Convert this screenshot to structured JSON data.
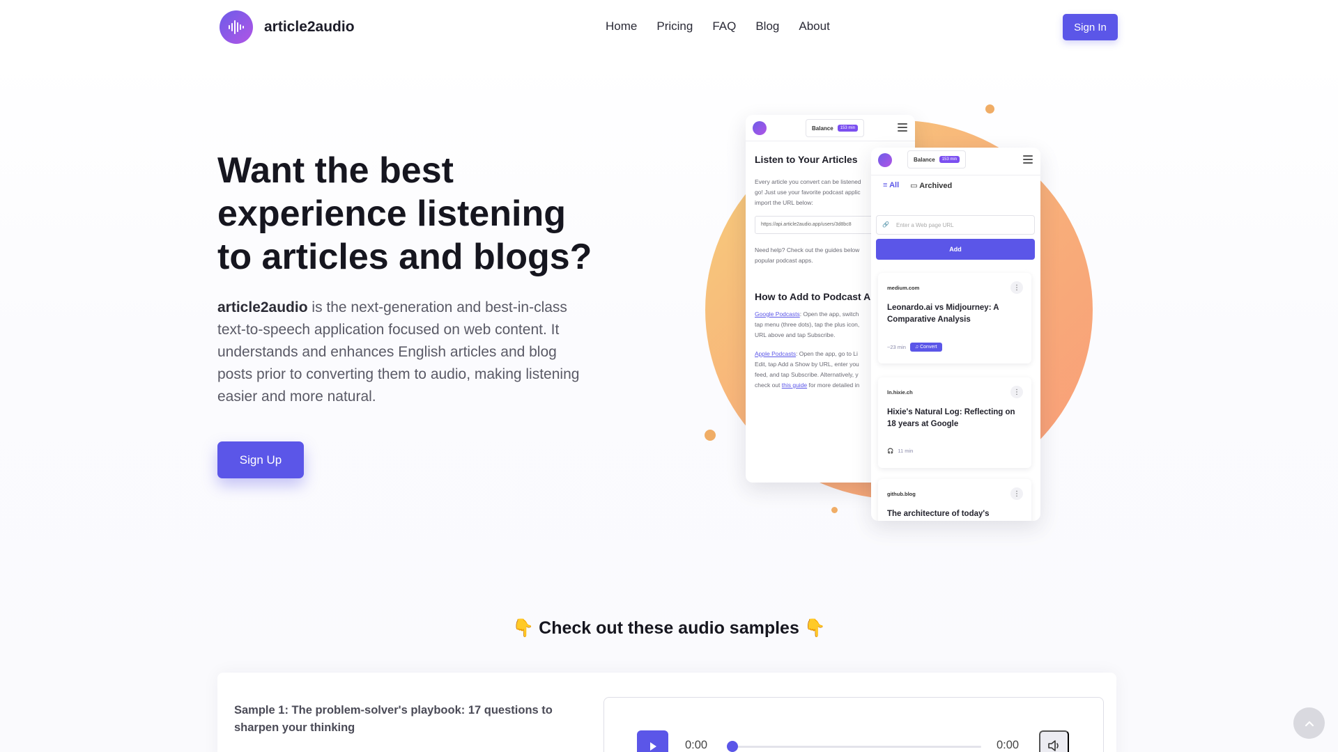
{
  "brand": {
    "name": "article2audio"
  },
  "nav": {
    "items": [
      {
        "label": "Home"
      },
      {
        "label": "Pricing"
      },
      {
        "label": "FAQ"
      },
      {
        "label": "Blog"
      },
      {
        "label": "About"
      }
    ],
    "signin_label": "Sign In"
  },
  "hero": {
    "title": "Want the best experience listening to articles and blogs?",
    "desc_brand": "article2audio",
    "desc_rest": " is the next-generation and best-in-class text-to-speech application focused on web content. It understands and enhances English articles and blog posts prior to converting them to audio, making listening easier and more natural.",
    "signup_label": "Sign Up"
  },
  "mockup": {
    "balance_label": "Balance",
    "balance_value": "153 min",
    "phone1": {
      "title": "Listen to Your Articles",
      "intro_lines": [
        "Every article you convert can be listened",
        "go! Just use your favorite podcast applic",
        "import the URL below:"
      ],
      "feed_url": "https://api.article2audio.app/users/3d8bc8",
      "help_lines": [
        "Need help? Check out the guides below",
        "popular podcast apps."
      ],
      "how_title": "How to Add to Podcast A",
      "google_link": "Google Podcasts",
      "google_lines": [
        ": Open the app, switch",
        "tap menu (three dots), tap the plus icon,",
        "URL above and tap Subscribe."
      ],
      "apple_link": "Apple Podcasts",
      "apple_lines": [
        ": Open the app, go to Li",
        "Edit, tap Add a Show by URL, enter you",
        "feed, and tap Subscribe. Alternatively, y"
      ],
      "guide_prefix": "check out ",
      "guide_link": "this guide",
      "guide_suffix": " for more detailed in"
    },
    "phone2": {
      "tab_all": "All",
      "tab_archived": "Archived",
      "url_placeholder": "Enter a Web page URL",
      "add_label": "Add",
      "cards": [
        {
          "source": "medium.com",
          "title": "Leonardo.ai vs Midjourney: A Comparative Analysis",
          "duration": "~23 min",
          "action": "Convert"
        },
        {
          "source": "ln.hixie.ch",
          "title": "Hixie's Natural Log: Reflecting on 18 years at Google",
          "duration": "11 min"
        },
        {
          "source": "github.blog",
          "title": "The architecture of today's"
        }
      ]
    }
  },
  "samples": {
    "heading": "👇 Check out these audio samples 👇",
    "items": [
      {
        "title": "Sample 1: The problem-solver's playbook: 17 questions to sharpen your thinking",
        "current_time": "0:00",
        "duration": "0:00",
        "progress": 0
      }
    ]
  },
  "colors": {
    "accent": "#5b56e8",
    "blob": "#f8b37a",
    "dots": "#f0ad66"
  },
  "icons": {
    "logo": "sound-wave-icon",
    "play": "play-icon",
    "volume": "volume-icon",
    "scroll_top": "chevron-up-icon"
  }
}
